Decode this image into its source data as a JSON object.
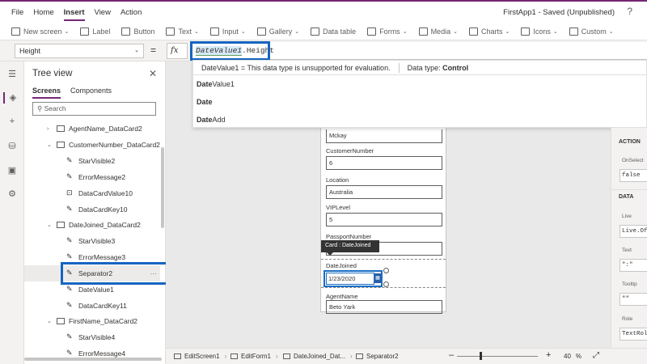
{
  "menu": [
    "File",
    "Home",
    "Insert",
    "View",
    "Action"
  ],
  "menu_active_index": 2,
  "app_title": "FirstApp1 - Saved (Unpublished)",
  "ribbon": [
    {
      "label": "New screen",
      "icon": "new-screen-icon",
      "dropdown": true
    },
    {
      "label": "Label",
      "icon": "label-icon",
      "dropdown": false
    },
    {
      "label": "Button",
      "icon": "button-icon",
      "dropdown": false
    },
    {
      "label": "Text",
      "icon": "text-icon",
      "dropdown": true
    },
    {
      "label": "Input",
      "icon": "input-icon",
      "dropdown": true
    },
    {
      "label": "Gallery",
      "icon": "gallery-icon",
      "dropdown": true
    },
    {
      "label": "Data table",
      "icon": "data-table-icon",
      "dropdown": false
    },
    {
      "label": "Forms",
      "icon": "forms-icon",
      "dropdown": true
    },
    {
      "label": "Media",
      "icon": "media-icon",
      "dropdown": true
    },
    {
      "label": "Charts",
      "icon": "charts-icon",
      "dropdown": true
    },
    {
      "label": "Icons",
      "icon": "icons-icon",
      "dropdown": true
    },
    {
      "label": "Custom",
      "icon": "custom-icon",
      "dropdown": true
    }
  ],
  "formula_bar": {
    "property": "Height",
    "equals": "=",
    "fx": "fx",
    "formula_var": "DateValue1",
    "formula_rest": ".Height"
  },
  "intellisense": {
    "message": "DateValue1  =  This data type is unsupported for evaluation.",
    "datatype_label": "Data type:",
    "datatype_value": "Control",
    "suggestions": [
      {
        "bold": "Date",
        "rest": "Value1"
      },
      {
        "bold": "Date",
        "rest": ""
      },
      {
        "bold": "Date",
        "rest": "Add"
      }
    ]
  },
  "tree_view": {
    "title": "Tree view",
    "tabs": [
      "Screens",
      "Components"
    ],
    "active_tab": 0,
    "search_placeholder": "Search",
    "rows": [
      {
        "label": "AgentName_DataCard2",
        "type": "card",
        "expanded": false
      },
      {
        "label": "CustomerNumber_DataCard2",
        "type": "card",
        "expanded": true
      },
      {
        "label": "StarVisible2",
        "type": "edit"
      },
      {
        "label": "ErrorMessage2",
        "type": "edit"
      },
      {
        "label": "DataCardValue10",
        "type": "input"
      },
      {
        "label": "DataCardKey10",
        "type": "edit"
      },
      {
        "label": "DateJoined_DataCard2",
        "type": "card",
        "expanded": true
      },
      {
        "label": "StarVisible3",
        "type": "edit"
      },
      {
        "label": "ErrorMessage3",
        "type": "edit"
      },
      {
        "label": "Separator2",
        "type": "edit",
        "selected": true
      },
      {
        "label": "DateValue1",
        "type": "edit"
      },
      {
        "label": "DataCardKey11",
        "type": "edit"
      },
      {
        "label": "FirstName_DataCard2",
        "type": "card",
        "expanded": true
      },
      {
        "label": "StarVisible4",
        "type": "edit"
      },
      {
        "label": "ErrorMessage4",
        "type": "edit"
      }
    ]
  },
  "form": {
    "top_value": "Mckay",
    "fields": [
      {
        "label": "CustomerNumber",
        "value": "6"
      },
      {
        "label": "Location",
        "value": "Australia"
      },
      {
        "label": "VIPLevel",
        "value": "5"
      },
      {
        "label": "PassportNumber",
        "value": ""
      }
    ],
    "datejoined_label": "DateJoined",
    "datejoined_value": "1/23/2020",
    "agentname_label": "AgentName",
    "agentname_value": "Beto Yark",
    "tooltip": "Card : DateJoined"
  },
  "right_panel": {
    "action_header": "ACTION",
    "onselect_label": "OnSelect",
    "onselect_value": "false",
    "data_header": "DATA",
    "live_label": "Live",
    "live_value": "Live.Of",
    "text_label": "Text",
    "text_value": "\":\"",
    "tooltip_label": "Tooltip",
    "tooltip_value": "\"\"",
    "role_label": "Role",
    "role_value": "TextRol"
  },
  "status_bar": {
    "crumbs": [
      "EditScreen1",
      "EditForm1",
      "DateJoined_Dat...",
      "Separator2"
    ],
    "zoom_minus": "–",
    "zoom_plus": "+",
    "zoom_value": "40",
    "zoom_unit": "%",
    "zoom_percent": 40
  }
}
